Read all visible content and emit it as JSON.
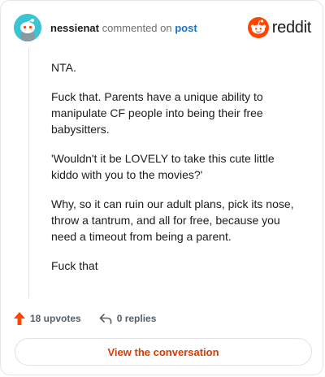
{
  "comment": {
    "author": "nessienat",
    "action_text": "commented on",
    "link_text": "post",
    "paragraphs": [
      "NTA.",
      "Fuck that. Parents have a unique ability to manipulate CF people into being their free babysitters.",
      "'Wouldn't it be LOVELY to take this cute little kiddo with you to the movies?'",
      "Why, so it can ruin our adult plans, pick its nose, throw a tantrum, and all for free, because you need a timeout from being a parent.",
      "Fuck that"
    ]
  },
  "brand": {
    "name": "reddit",
    "color": "#ff4500"
  },
  "actions": {
    "upvotes": "18 upvotes",
    "replies": "0 replies"
  },
  "cta": {
    "label": "View the conversation"
  },
  "colors": {
    "accent": "#d93a00",
    "link": "#1a73c7",
    "avatar": "#3bc4d4"
  },
  "icons": [
    "snoo-avatar-icon",
    "reddit-logo-icon",
    "upvote-arrow-icon",
    "reply-icon"
  ]
}
